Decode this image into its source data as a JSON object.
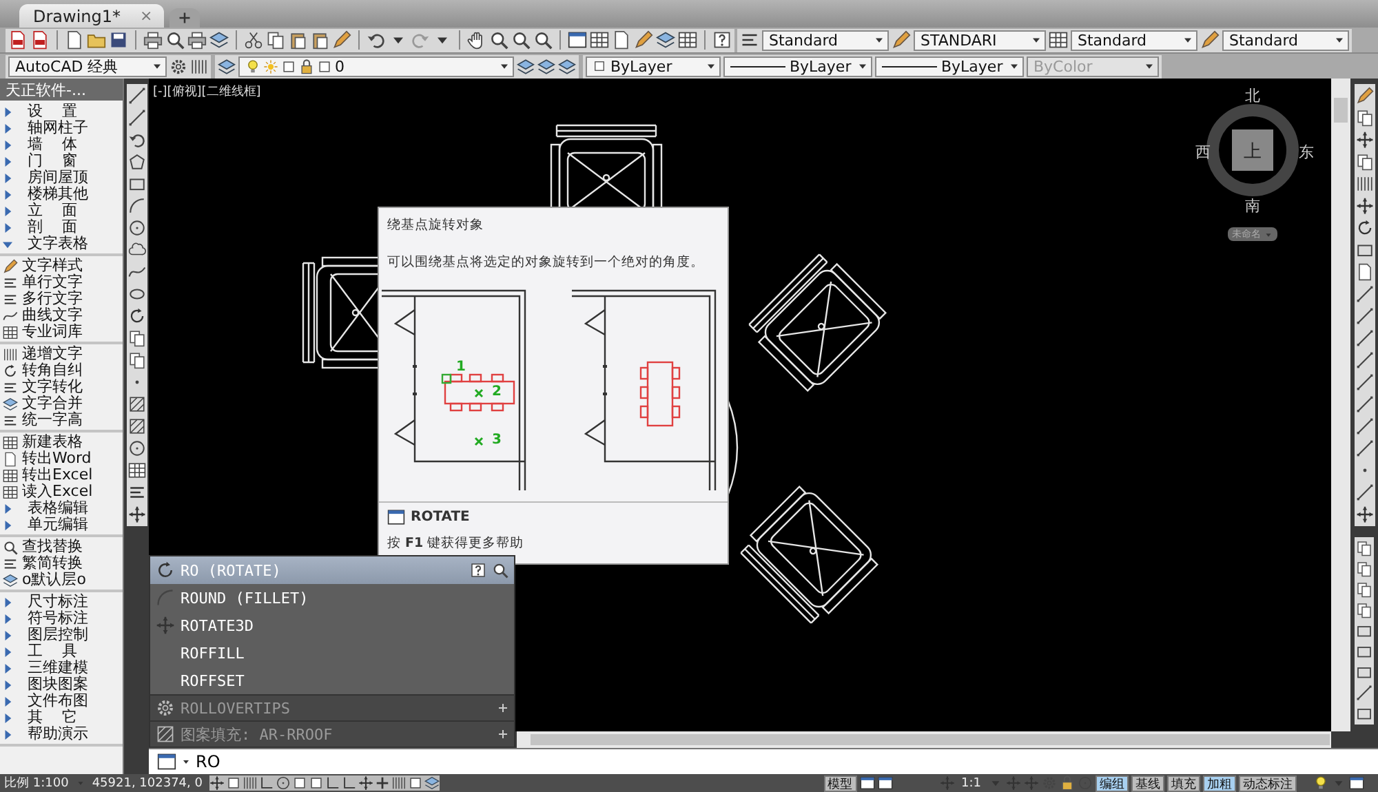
{
  "document_tabs": [
    {
      "label": "Drawing1*",
      "selected": true,
      "close": "×"
    }
  ],
  "style_toolbar": [
    {
      "value": "Standard",
      "kind": "text"
    },
    {
      "value": "STANDARI",
      "kind": "dimension"
    },
    {
      "value": "Standard",
      "kind": "table"
    },
    {
      "value": "Standard",
      "kind": "multileader"
    }
  ],
  "workspace": "AutoCAD 经典",
  "layer": "0",
  "properties": [
    {
      "value": "ByLayer",
      "kind": "color",
      "disabled": false
    },
    {
      "value": "ByLayer",
      "kind": "linetype",
      "disabled": false
    },
    {
      "value": "ByLayer",
      "kind": "lineweight",
      "disabled": false
    },
    {
      "value": "ByColor",
      "kind": "plotstyle",
      "disabled": true
    }
  ],
  "side_menu": {
    "title": "天正软件-...",
    "sections": [
      [
        {
          "label": "设    置",
          "kind": "group",
          "expanded": false
        },
        {
          "label": "轴网柱子",
          "kind": "group",
          "expanded": false
        },
        {
          "label": "墙    体",
          "kind": "group",
          "expanded": false
        },
        {
          "label": "门    窗",
          "kind": "group",
          "expanded": false
        },
        {
          "label": "房间屋顶",
          "kind": "group",
          "expanded": false
        },
        {
          "label": "楼梯其他",
          "kind": "group",
          "expanded": false
        },
        {
          "label": "立    面",
          "kind": "group",
          "expanded": false
        },
        {
          "label": "剖    面",
          "kind": "group",
          "expanded": false
        },
        {
          "label": "文字表格",
          "kind": "group",
          "expanded": true
        }
      ],
      [
        {
          "label": "文字样式",
          "kind": "command"
        },
        {
          "label": "单行文字",
          "kind": "command"
        },
        {
          "label": "多行文字",
          "kind": "command"
        },
        {
          "label": "曲线文字",
          "kind": "command"
        },
        {
          "label": "专业词库",
          "kind": "command"
        }
      ],
      [
        {
          "label": "递增文字",
          "kind": "command"
        },
        {
          "label": "转角自纠",
          "kind": "command"
        },
        {
          "label": "文字转化",
          "kind": "command"
        },
        {
          "label": "文字合并",
          "kind": "command"
        },
        {
          "label": "统一字高",
          "kind": "command"
        }
      ],
      [
        {
          "label": "新建表格",
          "kind": "command"
        },
        {
          "label": "转出Word",
          "kind": "command"
        },
        {
          "label": "转出Excel",
          "kind": "command"
        },
        {
          "label": "读入Excel",
          "kind": "command"
        },
        {
          "label": "表格编辑",
          "kind": "group",
          "expanded": false
        },
        {
          "label": "单元编辑",
          "kind": "group",
          "expanded": false
        }
      ],
      [
        {
          "label": "查找替换",
          "kind": "command"
        },
        {
          "label": "繁简转换",
          "kind": "command"
        },
        {
          "label": "o默认层o",
          "kind": "command"
        }
      ],
      [
        {
          "label": "尺寸标注",
          "kind": "group",
          "expanded": false
        },
        {
          "label": "符号标注",
          "kind": "group",
          "expanded": false
        },
        {
          "label": "图层控制",
          "kind": "group",
          "expanded": false
        },
        {
          "label": "工    具",
          "kind": "group",
          "expanded": false
        },
        {
          "label": "三维建模",
          "kind": "group",
          "expanded": false
        },
        {
          "label": "图块图案",
          "kind": "group",
          "expanded": false
        },
        {
          "label": "文件布图",
          "kind": "group",
          "expanded": false
        },
        {
          "label": "其    它",
          "kind": "group",
          "expanded": false
        },
        {
          "label": "帮助演示",
          "kind": "group",
          "expanded": false
        }
      ]
    ]
  },
  "canvas": {
    "viewport_label": "[-][俯视][二维线框]",
    "compass": {
      "north": "北",
      "south": "南",
      "east": "东",
      "west": "西",
      "face": "上",
      "ucs": "未命名"
    }
  },
  "tooltip": {
    "title": "绕基点旋转对象",
    "description": "可以围绕基点将选定的对象旋转到一个绝对的角度。",
    "markers": [
      "1",
      "2",
      "3"
    ],
    "command": "ROTATE",
    "help": "按 **F1** 键获得更多帮助"
  },
  "autocomplete": {
    "items": [
      {
        "label": "RO (ROTATE)",
        "selected": true,
        "kind": "rotate"
      },
      {
        "label": "ROUND (FILLET)",
        "selected": false,
        "kind": "fillet"
      },
      {
        "label": "ROTATE3D",
        "selected": false,
        "kind": "rotate3d"
      },
      {
        "label": "ROFFILL",
        "selected": false,
        "kind": "plain"
      },
      {
        "label": "ROFFSET",
        "selected": false,
        "kind": "plain"
      }
    ],
    "categories": [
      {
        "label": "ROLLOVERTIPS",
        "kind": "sysvar"
      },
      {
        "label": "图案填充: AR-RROOF",
        "kind": "hatch"
      }
    ]
  },
  "command_line": {
    "value": "RO"
  },
  "status_bar": {
    "scale": "比例 1:100",
    "coordinates": "45921, 102374, 0",
    "model": "模型",
    "annotation_scale": "1:1",
    "toggles": [
      {
        "label": "编组",
        "on": true
      },
      {
        "label": "基线",
        "on": false
      },
      {
        "label": "填充",
        "on": false
      },
      {
        "label": "加粗",
        "on": true
      },
      {
        "label": "动态标注",
        "on": false
      }
    ]
  }
}
